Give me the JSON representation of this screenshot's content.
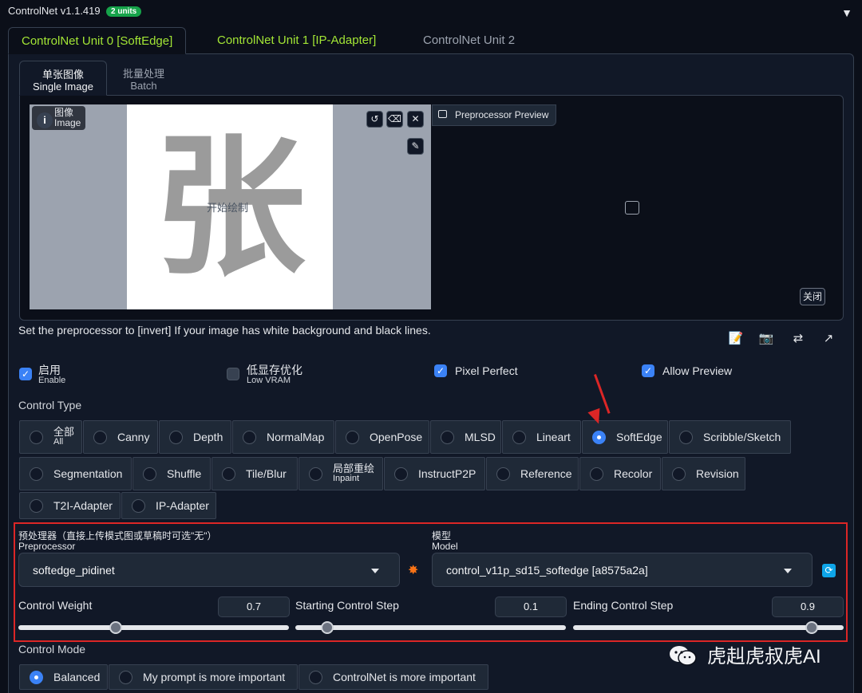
{
  "header": {
    "title": "ControlNet v1.1.419",
    "badge": "2 units",
    "collapse_icon": "▼"
  },
  "unit_tabs": [
    {
      "label": "ControlNet Unit 0 [SoftEdge]",
      "active": true
    },
    {
      "label": "ControlNet Unit 1 [IP-Adapter]",
      "active": false
    },
    {
      "label": "ControlNet Unit 2",
      "active": false
    }
  ],
  "image_tabs": [
    {
      "zh": "单张图像",
      "en": "Single Image",
      "active": true
    },
    {
      "zh": "批量处理",
      "en": "Batch",
      "active": false
    }
  ],
  "image_area": {
    "label_zh": "图像",
    "label_en": "Image",
    "glyph": "张",
    "start_draw": "开始绘制",
    "preprocessor_preview": "Preprocessor Preview",
    "close_label": "关闭"
  },
  "hint_text": "Set the preprocessor to [invert] If your image has white background and black lines.",
  "checkboxes": [
    {
      "zh": "启用",
      "en": "Enable",
      "checked": true
    },
    {
      "zh": "低显存优化",
      "en": "Low VRAM",
      "checked": false
    },
    {
      "label": "Pixel Perfect",
      "checked": true
    },
    {
      "label": "Allow Preview",
      "checked": true
    }
  ],
  "control_type": {
    "label": "Control Type",
    "row1": [
      {
        "zh": "全部",
        "en": "All"
      },
      {
        "label": "Canny"
      },
      {
        "label": "Depth"
      },
      {
        "label": "NormalMap"
      },
      {
        "label": "OpenPose"
      },
      {
        "label": "MLSD"
      },
      {
        "label": "Lineart"
      },
      {
        "label": "SoftEdge",
        "selected": true
      },
      {
        "label": "Scribble/Sketch"
      }
    ],
    "row2": [
      {
        "label": "Segmentation"
      },
      {
        "label": "Shuffle"
      },
      {
        "label": "Tile/Blur"
      },
      {
        "zh": "局部重绘",
        "en": "Inpaint"
      },
      {
        "label": "InstructP2P"
      },
      {
        "label": "Reference"
      },
      {
        "label": "Recolor"
      },
      {
        "label": "Revision"
      }
    ],
    "row3": [
      {
        "label": "T2I-Adapter"
      },
      {
        "label": "IP-Adapter"
      }
    ]
  },
  "preprocessor": {
    "label_zh": "预处理器（直接上传模式图或草稿时可选\"无\"）",
    "label_en": "Preprocessor",
    "value": "softedge_pidinet"
  },
  "model": {
    "label_zh": "模型",
    "label_en": "Model",
    "value": "control_v11p_sd15_softedge [a8575a2a]"
  },
  "sliders": [
    {
      "label": "Control Weight",
      "value": "0.7"
    },
    {
      "label": "Starting Control Step",
      "value": "0.1"
    },
    {
      "label": "Ending Control Step",
      "value": "0.9"
    }
  ],
  "control_mode": {
    "label": "Control Mode",
    "options": [
      {
        "label": "Balanced",
        "selected": true
      },
      {
        "label": "My prompt is more important"
      },
      {
        "label": "ControlNet is more important"
      }
    ]
  },
  "watermark": "虎赳虎叔虎AI",
  "colors": {
    "accent_green": "#a3e635",
    "accent_blue": "#3b82f6",
    "highlight_red": "#dc2626"
  }
}
